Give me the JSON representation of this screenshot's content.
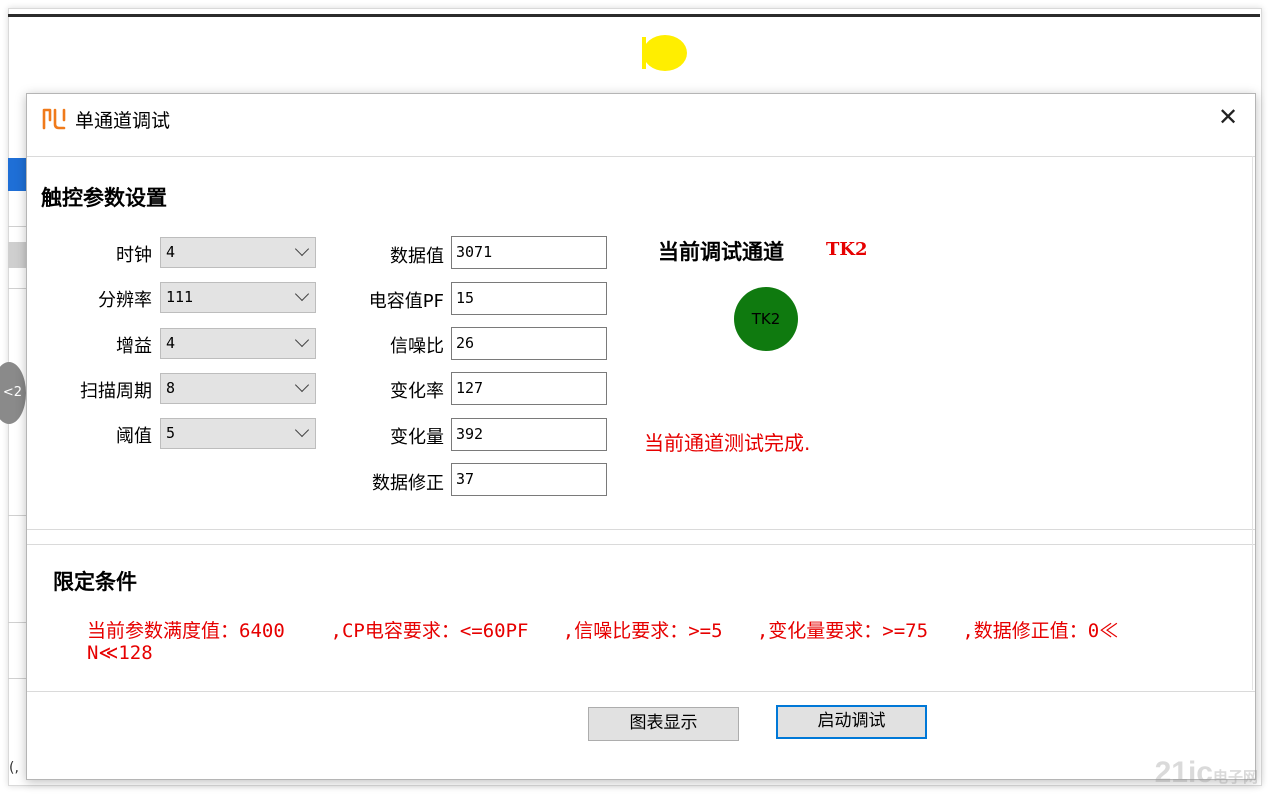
{
  "dialog": {
    "title": "单通道调试",
    "close_glyph": "✕"
  },
  "params": {
    "section_title": "触控参数设置",
    "selects": [
      {
        "label": "时钟",
        "value": "4"
      },
      {
        "label": "分辨率",
        "value": "111"
      },
      {
        "label": "增益",
        "value": "4"
      },
      {
        "label": "扫描周期",
        "value": "8"
      },
      {
        "label": "阈值",
        "value": "5"
      }
    ],
    "fields": [
      {
        "label": "数据值",
        "value": "3071"
      },
      {
        "label": "电容值PF",
        "value": "15"
      },
      {
        "label": "信噪比",
        "value": "26"
      },
      {
        "label": "变化率",
        "value": "127"
      },
      {
        "label": "变化量",
        "value": "392"
      },
      {
        "label": "数据修正",
        "value": "37"
      }
    ]
  },
  "channel": {
    "label": "当前调试通道",
    "value": "TK2",
    "indicator_text": "TK2",
    "indicator_color": "#0f7a0f",
    "status": "当前通道测试完成."
  },
  "limits": {
    "section_title": "限定条件",
    "line1": "当前参数满度值：6400    ,CP电容要求：<=60PF   ,信噪比要求：>=5   ,变化量要求：>=75   ,数据修正值：0≪",
    "line2": "N≪128"
  },
  "buttons": {
    "chart": "图表显示",
    "start": "启动调试"
  },
  "background": {
    "side_label": "<2",
    "bottom_text": "(,"
  },
  "watermark": {
    "main": "21ic",
    "sub": "电子网"
  },
  "colors": {
    "accent": "#0078d7",
    "alert": "#e60000",
    "indicator": "#0f7a0f"
  }
}
